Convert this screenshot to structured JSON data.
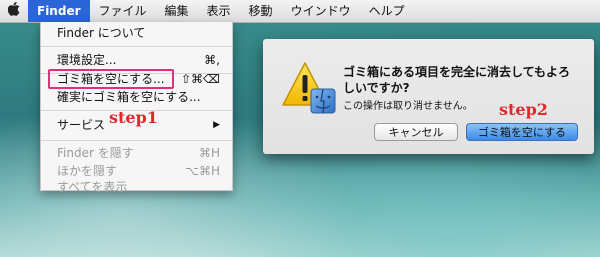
{
  "menubar": {
    "apple_icon": "apple-icon",
    "items": [
      "Finder",
      "ファイル",
      "編集",
      "表示",
      "移動",
      "ウインドウ",
      "ヘルプ"
    ]
  },
  "finder_menu": {
    "about": "Finder について",
    "preferences": {
      "label": "環境設定...",
      "shortcut": "⌘,"
    },
    "empty_trash": {
      "label": "ゴミ箱を空にする...",
      "shortcut": "⇧⌘⌫"
    },
    "secure_empty_trash": {
      "label": "確実にゴミ箱を空にする..."
    },
    "services": {
      "label": "サービス",
      "arrow": "▶"
    },
    "hide_finder": {
      "label": "Finder を隠す",
      "shortcut": "⌘H"
    },
    "hide_others": {
      "label": "ほかを隠す",
      "shortcut": "⌥⌘H"
    },
    "show_all": {
      "label": "すべてを表示"
    }
  },
  "annotations": {
    "step1": "step1",
    "step2": "step2",
    "highlight_color": "#e0307c",
    "step_color": "#e2282d"
  },
  "dialog": {
    "title": "ゴミ箱にある項目を完全に消去してもよろしいですか?",
    "message": "この操作は取り消せません。",
    "cancel_label": "キャンセル",
    "confirm_label": "ゴミ箱を空にする",
    "icon": "warning-icon"
  }
}
